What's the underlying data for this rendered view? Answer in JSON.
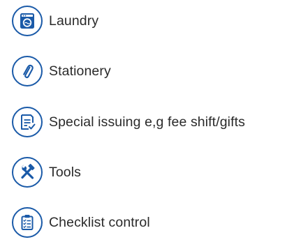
{
  "categories": [
    {
      "label": "Laundry",
      "icon": "washing-machine-icon"
    },
    {
      "label": "Stationery",
      "icon": "paperclip-icon"
    },
    {
      "label": "Special issuing e,g fee shift/gifts",
      "icon": "document-check-icon"
    },
    {
      "label": "Tools",
      "icon": "hammer-wrench-icon"
    },
    {
      "label": "Checklist control",
      "icon": "clipboard-checklist-icon"
    }
  ],
  "colors": {
    "icon_blue": "#1a5aa8",
    "text": "#2a2a2a"
  }
}
